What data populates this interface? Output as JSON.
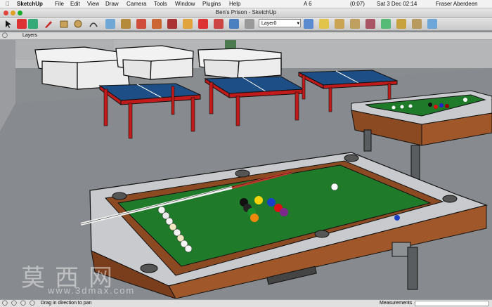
{
  "menubar": {
    "app": "SketchUp",
    "items": [
      "File",
      "Edit",
      "View",
      "Draw",
      "Camera",
      "Tools",
      "Window",
      "Plugins",
      "Help"
    ],
    "battery": "(0:07)",
    "datetime": "Sat 3 Dec  02:14",
    "user": "Fraser Aberdeen",
    "input_indicator": "A 6"
  },
  "window": {
    "title": "Ben's Prison - SketchUp"
  },
  "toolbar": {
    "layer_value": "Layer0"
  },
  "layers_panel": {
    "label": "Layers"
  },
  "status": {
    "hint": "Drag in direction to pan",
    "measurements_label": "Measurements"
  },
  "watermark": {
    "text": "莫西网",
    "url": "www.3dmax.com"
  },
  "colors": {
    "felt": "#1f7a2a",
    "table_wood": "#8b4a22",
    "tt_top": "#1d4e86",
    "tt_legs": "#c11a1a",
    "floor": "#8a8d90"
  }
}
